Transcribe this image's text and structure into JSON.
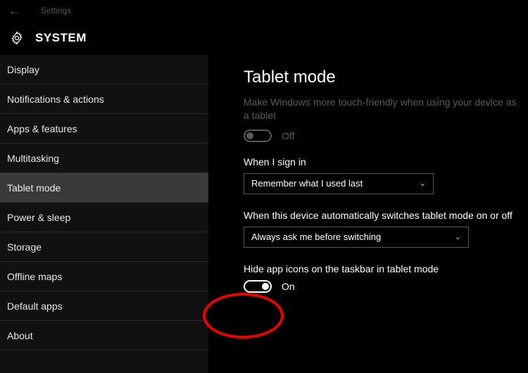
{
  "header": {
    "title": "Settings"
  },
  "section": {
    "title": "SYSTEM"
  },
  "sidebar": {
    "items": [
      {
        "label": "Display"
      },
      {
        "label": "Notifications & actions"
      },
      {
        "label": "Apps & features"
      },
      {
        "label": "Multitasking"
      },
      {
        "label": "Tablet mode"
      },
      {
        "label": "Power & sleep"
      },
      {
        "label": "Storage"
      },
      {
        "label": "Offline maps"
      },
      {
        "label": "Default apps"
      },
      {
        "label": "About"
      }
    ],
    "selected_index": 4
  },
  "main": {
    "title": "Tablet mode",
    "subtitle": "Make Windows more touch-friendly when using your device as a tablet",
    "toggle_main": {
      "value": "Off",
      "state": "off",
      "enabled": false
    },
    "signin_label": "When I sign in",
    "signin_value": "Remember what I used last",
    "switch_label": "When this device automatically switches tablet mode on or off",
    "switch_value": "Always ask me before switching",
    "hide_icons_label": "Hide app icons on the taskbar in tablet mode",
    "hide_icons_toggle": {
      "value": "On",
      "state": "on"
    }
  }
}
